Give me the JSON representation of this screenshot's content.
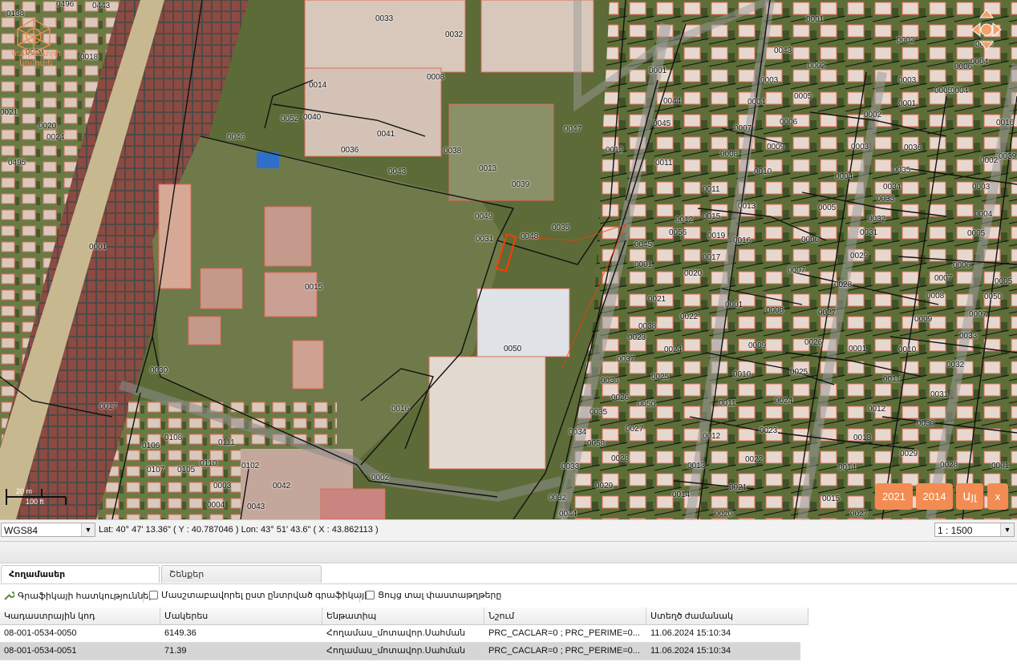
{
  "map": {
    "logo_text": "Կադաստրի կոմիտե",
    "scale_top": "20 m",
    "scale_bottom": "100 ft",
    "year_buttons": [
      "2021",
      "2014"
    ],
    "layer_button": "Այլ",
    "close_button": "x",
    "parcel_labels": [
      {
        "t": "0138"
      },
      {
        "t": "0496"
      },
      {
        "t": "0443"
      },
      {
        "t": "0019"
      },
      {
        "t": "0018"
      },
      {
        "t": "0021"
      },
      {
        "t": "0020"
      },
      {
        "t": "0024"
      },
      {
        "t": "0495"
      },
      {
        "t": "0033"
      },
      {
        "t": "0032"
      },
      {
        "t": "0008"
      },
      {
        "t": "0014"
      },
      {
        "t": "0052"
      },
      {
        "t": "0040"
      },
      {
        "t": "0041"
      },
      {
        "t": "0036"
      },
      {
        "t": "0046"
      },
      {
        "t": "0043"
      },
      {
        "t": "0038"
      },
      {
        "t": "0013"
      },
      {
        "t": "0039"
      },
      {
        "t": "0047"
      },
      {
        "t": "0012"
      },
      {
        "t": "0011"
      },
      {
        "t": "0044"
      },
      {
        "t": "0045"
      },
      {
        "t": "0001"
      },
      {
        "t": "0049"
      },
      {
        "t": "0031"
      },
      {
        "t": "0048"
      },
      {
        "t": "0035"
      },
      {
        "t": "0001"
      },
      {
        "t": "0015"
      },
      {
        "t": "0050"
      },
      {
        "t": "0030"
      },
      {
        "t": "0017"
      },
      {
        "t": "0016"
      },
      {
        "t": "0002"
      },
      {
        "t": "0106"
      },
      {
        "t": "0108"
      },
      {
        "t": "0107"
      },
      {
        "t": "0105"
      },
      {
        "t": "0110"
      },
      {
        "t": "0111"
      },
      {
        "t": "0003"
      },
      {
        "t": "0102"
      },
      {
        "t": "0042"
      },
      {
        "t": "0004"
      },
      {
        "t": "0043"
      },
      {
        "t": "0001"
      },
      {
        "t": "0043"
      },
      {
        "t": "0002"
      },
      {
        "t": "0003"
      },
      {
        "t": "0005"
      },
      {
        "t": "0004"
      },
      {
        "t": "0006"
      },
      {
        "t": "0007"
      },
      {
        "t": "0009"
      },
      {
        "t": "0008"
      },
      {
        "t": "0010"
      },
      {
        "t": "0011"
      },
      {
        "t": "0013"
      },
      {
        "t": "0012"
      },
      {
        "t": "0015"
      },
      {
        "t": "0056"
      },
      {
        "t": "0019"
      },
      {
        "t": "0016"
      },
      {
        "t": "0017"
      },
      {
        "t": "0020"
      },
      {
        "t": "0021"
      },
      {
        "t": "0022"
      },
      {
        "t": "0038"
      },
      {
        "t": "0023"
      },
      {
        "t": "0024"
      },
      {
        "t": "0037"
      },
      {
        "t": "0025"
      },
      {
        "t": "0036"
      },
      {
        "t": "0026"
      },
      {
        "t": "0050"
      },
      {
        "t": "0035"
      },
      {
        "t": "0027"
      },
      {
        "t": "0034"
      },
      {
        "t": "0058"
      },
      {
        "t": "0028"
      },
      {
        "t": "0033"
      },
      {
        "t": "0029"
      },
      {
        "t": "0032"
      },
      {
        "t": "0044"
      },
      {
        "t": "0045"
      },
      {
        "t": "0001"
      },
      {
        "t": "0001"
      },
      {
        "t": "0002"
      },
      {
        "t": "0003"
      },
      {
        "t": "0036"
      },
      {
        "t": "0004"
      },
      {
        "t": "0035"
      },
      {
        "t": "0034"
      },
      {
        "t": "0033"
      },
      {
        "t": "0005"
      },
      {
        "t": "0032"
      },
      {
        "t": "0031"
      },
      {
        "t": "0006"
      },
      {
        "t": "0029"
      },
      {
        "t": "0007"
      },
      {
        "t": "0028"
      },
      {
        "t": "0008"
      },
      {
        "t": "0027"
      },
      {
        "t": "0009"
      },
      {
        "t": "0026"
      },
      {
        "t": "0010"
      },
      {
        "t": "0025"
      },
      {
        "t": "0011"
      },
      {
        "t": "0024"
      },
      {
        "t": "0012"
      },
      {
        "t": "0023"
      },
      {
        "t": "0013"
      },
      {
        "t": "0022"
      },
      {
        "t": "0014"
      },
      {
        "t": "0021"
      },
      {
        "t": "0020"
      },
      {
        "t": "0001"
      },
      {
        "t": "0002"
      },
      {
        "t": "0003"
      },
      {
        "t": "0004"
      },
      {
        "t": "0005"
      },
      {
        "t": "0001"
      },
      {
        "t": "0002"
      },
      {
        "t": "0003"
      },
      {
        "t": "0004"
      },
      {
        "t": "0005"
      },
      {
        "t": "0006"
      },
      {
        "t": "0007"
      },
      {
        "t": "0008"
      },
      {
        "t": "0009"
      },
      {
        "t": "0010"
      },
      {
        "t": "0011"
      },
      {
        "t": "0012"
      },
      {
        "t": "0013"
      },
      {
        "t": "0014"
      },
      {
        "t": "0015"
      },
      {
        "t": "0016"
      },
      {
        "t": "0039"
      },
      {
        "t": "0002"
      },
      {
        "t": "0006"
      },
      {
        "t": "0004"
      },
      {
        "t": "0005"
      },
      {
        "t": "0050"
      },
      {
        "t": "0007"
      },
      {
        "t": "0033"
      },
      {
        "t": "0032"
      },
      {
        "t": "0031"
      },
      {
        "t": "0030"
      },
      {
        "t": "0029"
      },
      {
        "t": "0028"
      },
      {
        "t": "0027"
      },
      {
        "t": "0001"
      },
      {
        "t": "0001"
      },
      {
        "t": "0006"
      }
    ]
  },
  "coords": {
    "crs": "WGS84",
    "lat_label": "Lat: 40° 47' 13.36\" ( Y : 40.787046 ) Lon: 43° 51' 43.6\" ( X : 43.862113 )",
    "scale": "1 : 1500"
  },
  "tabs": [
    {
      "label": "Հողամասեր",
      "active": true
    },
    {
      "label": "Շենքեր",
      "active": false
    }
  ],
  "toolbar": {
    "graphics_props": "Գրաֆիկայի հատկություններ",
    "scale_by_selected": "Մասշտաբավորել ըստ ընտրված գրաֆիկայի",
    "show_documents": "Ցույց տալ փաստաթղթերը"
  },
  "grid": {
    "columns": [
      "Կադաստրային կոդ",
      "Մակերես",
      "Ենթատիպ",
      "Նշում",
      "Ստեղծ ժամանակ"
    ],
    "rows": [
      [
        "08-001-0534-0050",
        "6149.36",
        "Հողամաս_մոտավոր.Սահման",
        "PRC_CACLAR=0 ; PRC_PERIME=0...",
        "11.06.2024 15:10:34"
      ],
      [
        "08-001-0534-0051",
        "71.39",
        "Հողամաս_մոտավոր.Սահման",
        "PRC_CACLAR=0 ; PRC_PERIME=0...",
        "11.06.2024 15:10:34"
      ]
    ]
  }
}
